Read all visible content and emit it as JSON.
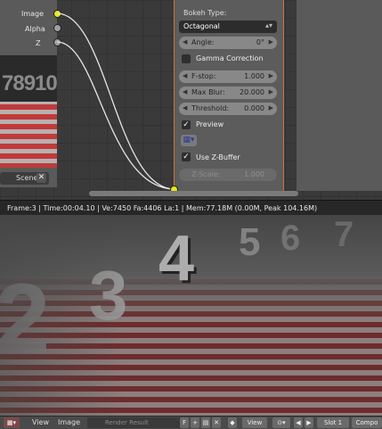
{
  "node_left": {
    "sockets": [
      "Image",
      "Alpha",
      "Z"
    ],
    "preview_digits": "78910",
    "scene_label": "Scene",
    "scene_close": "✕"
  },
  "bokeh": {
    "type_label": "Bokeh Type:",
    "type_value": "Octagonal",
    "angle": {
      "label": "Angle:",
      "value": "0°"
    },
    "gamma_label": "Gamma Correction",
    "fstop": {
      "label": "F-stop:",
      "value": "1.000"
    },
    "max_blur": {
      "label": "Max Blur:",
      "value": "20.000"
    },
    "threshold": {
      "label": "Threshold:",
      "value": "0.000"
    },
    "preview_label": "Preview",
    "use_zbuffer_label": "Use Z-Buffer",
    "zscale": {
      "label": "Z-Scale:",
      "value": "1.000"
    }
  },
  "status": {
    "info": "Frame:3 | Time:00:04.10 | Ve:7450 Fa:4406 La:1 | Mem:77.18M (0.00M, Peak 104.16M)"
  },
  "render": {
    "digits": [
      "2",
      "3",
      "4",
      "5",
      "6",
      "7"
    ]
  },
  "image_editor_header": {
    "menu_view": "View",
    "menu_image": "Image",
    "image_name": "Render Result",
    "fake_user": "F",
    "view_dropdown": "View",
    "slot": "Slot 1",
    "compositor": "Compo"
  },
  "colors": {
    "node_accent": "#d4722b",
    "socket_yellow": "#e8e81a",
    "socket_grey": "#a0a0a0"
  }
}
